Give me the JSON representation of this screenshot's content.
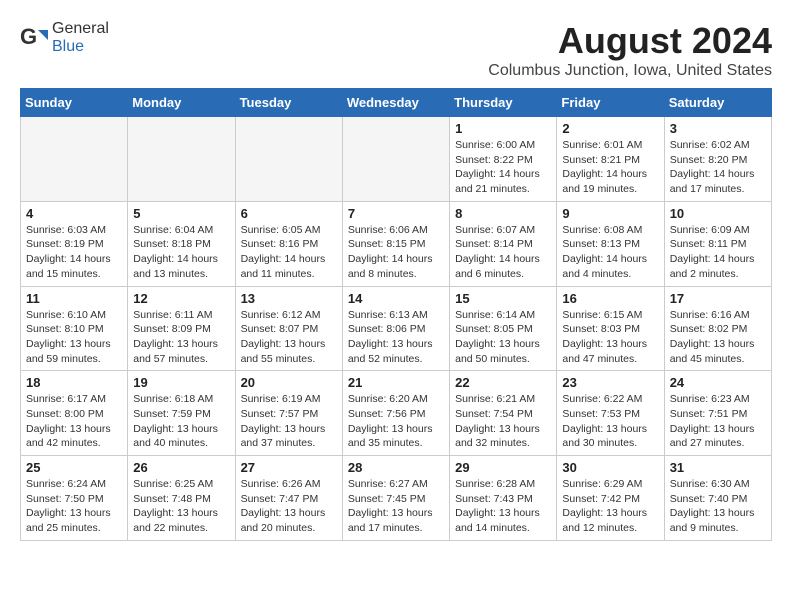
{
  "logo": {
    "general": "General",
    "blue": "Blue"
  },
  "header": {
    "title": "August 2024",
    "subtitle": "Columbus Junction, Iowa, United States"
  },
  "columns": [
    "Sunday",
    "Monday",
    "Tuesday",
    "Wednesday",
    "Thursday",
    "Friday",
    "Saturday"
  ],
  "weeks": [
    [
      {
        "day": "",
        "detail": "",
        "empty": true
      },
      {
        "day": "",
        "detail": "",
        "empty": true
      },
      {
        "day": "",
        "detail": "",
        "empty": true
      },
      {
        "day": "",
        "detail": "",
        "empty": true
      },
      {
        "day": "1",
        "detail": "Sunrise: 6:00 AM\nSunset: 8:22 PM\nDaylight: 14 hours\nand 21 minutes."
      },
      {
        "day": "2",
        "detail": "Sunrise: 6:01 AM\nSunset: 8:21 PM\nDaylight: 14 hours\nand 19 minutes."
      },
      {
        "day": "3",
        "detail": "Sunrise: 6:02 AM\nSunset: 8:20 PM\nDaylight: 14 hours\nand 17 minutes."
      }
    ],
    [
      {
        "day": "4",
        "detail": "Sunrise: 6:03 AM\nSunset: 8:19 PM\nDaylight: 14 hours\nand 15 minutes."
      },
      {
        "day": "5",
        "detail": "Sunrise: 6:04 AM\nSunset: 8:18 PM\nDaylight: 14 hours\nand 13 minutes."
      },
      {
        "day": "6",
        "detail": "Sunrise: 6:05 AM\nSunset: 8:16 PM\nDaylight: 14 hours\nand 11 minutes."
      },
      {
        "day": "7",
        "detail": "Sunrise: 6:06 AM\nSunset: 8:15 PM\nDaylight: 14 hours\nand 8 minutes."
      },
      {
        "day": "8",
        "detail": "Sunrise: 6:07 AM\nSunset: 8:14 PM\nDaylight: 14 hours\nand 6 minutes."
      },
      {
        "day": "9",
        "detail": "Sunrise: 6:08 AM\nSunset: 8:13 PM\nDaylight: 14 hours\nand 4 minutes."
      },
      {
        "day": "10",
        "detail": "Sunrise: 6:09 AM\nSunset: 8:11 PM\nDaylight: 14 hours\nand 2 minutes."
      }
    ],
    [
      {
        "day": "11",
        "detail": "Sunrise: 6:10 AM\nSunset: 8:10 PM\nDaylight: 13 hours\nand 59 minutes."
      },
      {
        "day": "12",
        "detail": "Sunrise: 6:11 AM\nSunset: 8:09 PM\nDaylight: 13 hours\nand 57 minutes."
      },
      {
        "day": "13",
        "detail": "Sunrise: 6:12 AM\nSunset: 8:07 PM\nDaylight: 13 hours\nand 55 minutes."
      },
      {
        "day": "14",
        "detail": "Sunrise: 6:13 AM\nSunset: 8:06 PM\nDaylight: 13 hours\nand 52 minutes."
      },
      {
        "day": "15",
        "detail": "Sunrise: 6:14 AM\nSunset: 8:05 PM\nDaylight: 13 hours\nand 50 minutes."
      },
      {
        "day": "16",
        "detail": "Sunrise: 6:15 AM\nSunset: 8:03 PM\nDaylight: 13 hours\nand 47 minutes."
      },
      {
        "day": "17",
        "detail": "Sunrise: 6:16 AM\nSunset: 8:02 PM\nDaylight: 13 hours\nand 45 minutes."
      }
    ],
    [
      {
        "day": "18",
        "detail": "Sunrise: 6:17 AM\nSunset: 8:00 PM\nDaylight: 13 hours\nand 42 minutes."
      },
      {
        "day": "19",
        "detail": "Sunrise: 6:18 AM\nSunset: 7:59 PM\nDaylight: 13 hours\nand 40 minutes."
      },
      {
        "day": "20",
        "detail": "Sunrise: 6:19 AM\nSunset: 7:57 PM\nDaylight: 13 hours\nand 37 minutes."
      },
      {
        "day": "21",
        "detail": "Sunrise: 6:20 AM\nSunset: 7:56 PM\nDaylight: 13 hours\nand 35 minutes."
      },
      {
        "day": "22",
        "detail": "Sunrise: 6:21 AM\nSunset: 7:54 PM\nDaylight: 13 hours\nand 32 minutes."
      },
      {
        "day": "23",
        "detail": "Sunrise: 6:22 AM\nSunset: 7:53 PM\nDaylight: 13 hours\nand 30 minutes."
      },
      {
        "day": "24",
        "detail": "Sunrise: 6:23 AM\nSunset: 7:51 PM\nDaylight: 13 hours\nand 27 minutes."
      }
    ],
    [
      {
        "day": "25",
        "detail": "Sunrise: 6:24 AM\nSunset: 7:50 PM\nDaylight: 13 hours\nand 25 minutes."
      },
      {
        "day": "26",
        "detail": "Sunrise: 6:25 AM\nSunset: 7:48 PM\nDaylight: 13 hours\nand 22 minutes."
      },
      {
        "day": "27",
        "detail": "Sunrise: 6:26 AM\nSunset: 7:47 PM\nDaylight: 13 hours\nand 20 minutes."
      },
      {
        "day": "28",
        "detail": "Sunrise: 6:27 AM\nSunset: 7:45 PM\nDaylight: 13 hours\nand 17 minutes."
      },
      {
        "day": "29",
        "detail": "Sunrise: 6:28 AM\nSunset: 7:43 PM\nDaylight: 13 hours\nand 14 minutes."
      },
      {
        "day": "30",
        "detail": "Sunrise: 6:29 AM\nSunset: 7:42 PM\nDaylight: 13 hours\nand 12 minutes."
      },
      {
        "day": "31",
        "detail": "Sunrise: 6:30 AM\nSunset: 7:40 PM\nDaylight: 13 hours\nand 9 minutes."
      }
    ]
  ]
}
